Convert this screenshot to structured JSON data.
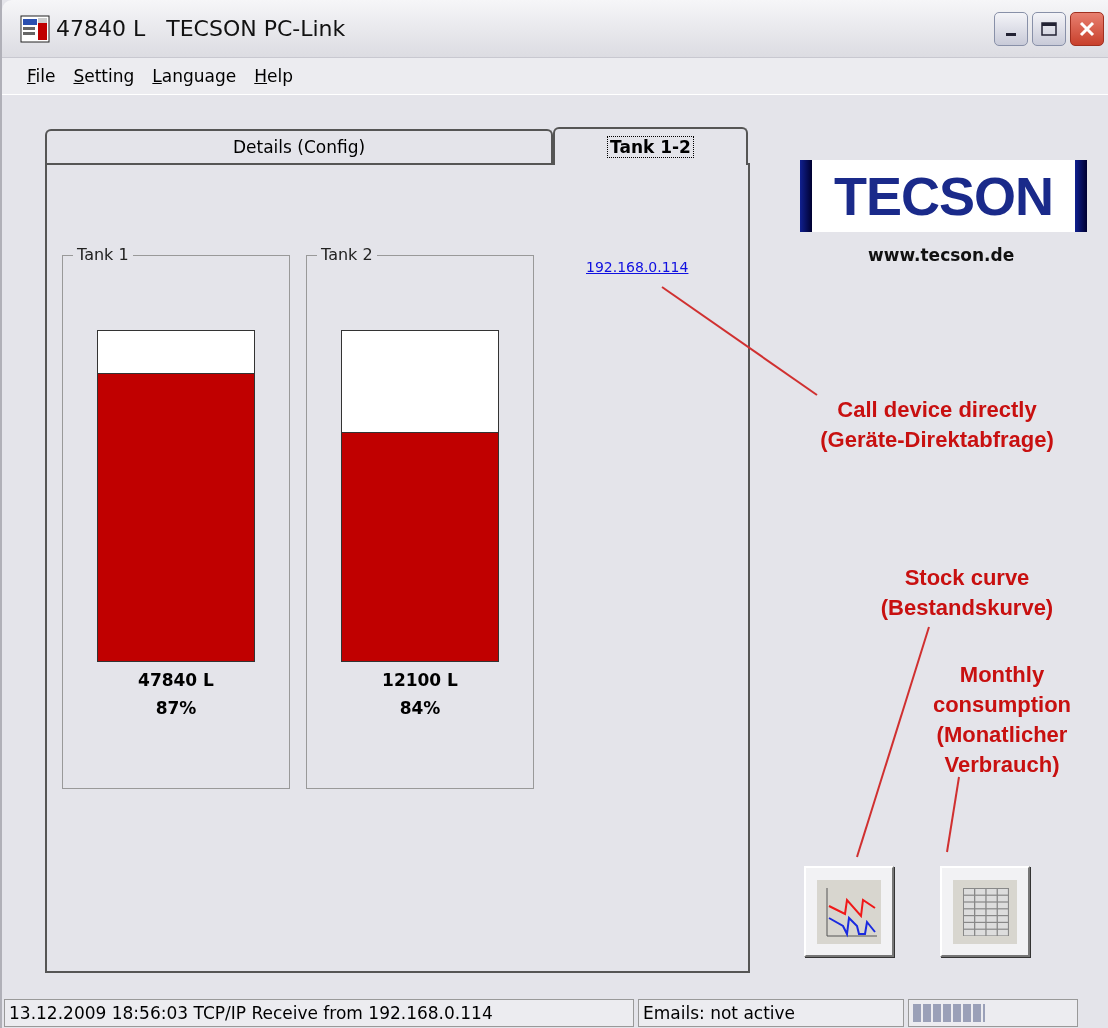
{
  "window": {
    "title": "47840 L   TECSON PC-Link"
  },
  "menu": [
    {
      "label": "File"
    },
    {
      "label": "Setting"
    },
    {
      "label": "Language"
    },
    {
      "label": "Help"
    }
  ],
  "tabs": [
    {
      "label": "Details (Config)",
      "selected": false
    },
    {
      "label": "Tank 1-2",
      "selected": true
    }
  ],
  "tanks": [
    {
      "name": "Tank 1",
      "level": 0.87,
      "volume": "47840 L",
      "percent": "87%"
    },
    {
      "name": "Tank 2",
      "level": 0.69,
      "volume": "12100 L",
      "percent": "84%"
    }
  ],
  "device_link": "192.168.0.114",
  "logo": {
    "name": "TECSON",
    "url": "www.tecson.de"
  },
  "annotations": [
    {
      "lines": [
        "Call device directly",
        "(Geräte-Direktabfrage)"
      ]
    },
    {
      "lines": [
        "Stock curve",
        "(Bestandskurve)"
      ]
    },
    {
      "lines": [
        "Monthly",
        "consumption",
        "(Monatlicher",
        "Verbrauch)"
      ]
    }
  ],
  "status_bar": {
    "message": "13.12.2009 18:56:03 TCP/IP Receive from 192.168.0.114",
    "email": "Emails: not active",
    "progress": {
      "level": 0.45
    }
  }
}
